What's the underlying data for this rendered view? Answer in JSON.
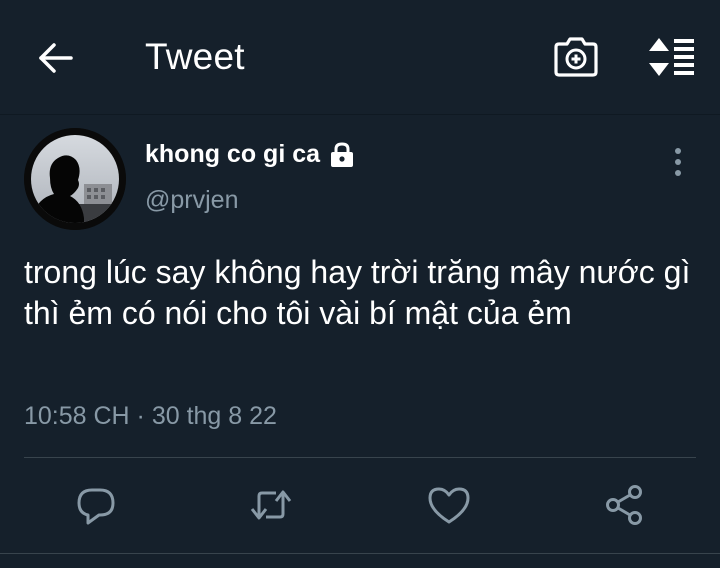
{
  "header": {
    "title": "Tweet",
    "icons": {
      "back": "arrow-left-icon",
      "camera": "camera-plus-icon",
      "sort": "sort-list-icon"
    }
  },
  "tweet": {
    "display_name": "khong co gi ca",
    "handle": "@prvjen",
    "protected": true,
    "text": "trong lúc say không hay trời trăng mây nước gì thì ẻm có nói cho tôi vài bí mật của ẻm",
    "timestamp": "10:58 CH · 30 thg 8 22"
  },
  "actions": [
    "reply-icon",
    "retweet-icon",
    "like-icon",
    "share-icon"
  ],
  "colors": {
    "background": "#15202b",
    "text_primary": "#ffffff",
    "text_secondary": "#8899a6",
    "divider": "#38444d"
  }
}
